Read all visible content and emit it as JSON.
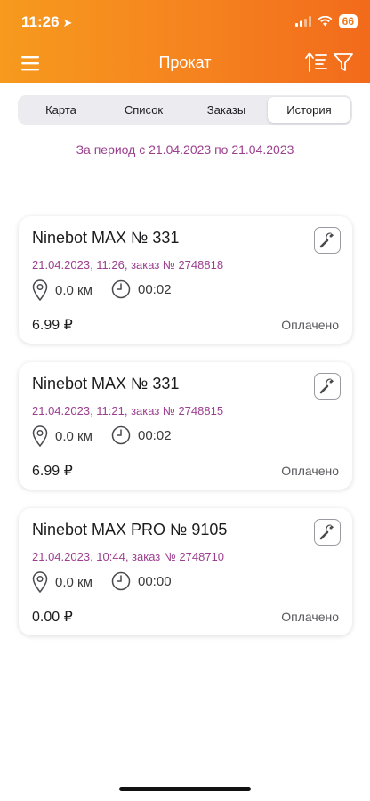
{
  "status_bar": {
    "time": "11:26",
    "battery": "66"
  },
  "header": {
    "title": "Прокат"
  },
  "tabs": [
    {
      "label": "Карта"
    },
    {
      "label": "Список"
    },
    {
      "label": "Заказы"
    },
    {
      "label": "История"
    }
  ],
  "active_tab": "История",
  "period": "За период с 21.04.2023 по 21.04.2023",
  "rides": [
    {
      "title": "Ninebot MAX № 331",
      "subtitle": "21.04.2023, 11:26, заказ № 2748818",
      "distance": "0.0 км",
      "duration": "00:02",
      "price": "6.99 ₽",
      "status": "Оплачено"
    },
    {
      "title": "Ninebot MAX № 331",
      "subtitle": "21.04.2023, 11:21, заказ № 2748815",
      "distance": "0.0 км",
      "duration": "00:02",
      "price": "6.99 ₽",
      "status": "Оплачено"
    },
    {
      "title": "Ninebot MAX PRO № 9105",
      "subtitle": "21.04.2023, 10:44, заказ № 2748710",
      "distance": "0.0 км",
      "duration": "00:00",
      "price": "0.00 ₽",
      "status": "Оплачено"
    }
  ],
  "colors": {
    "header_gradient_start": "#f79a1e",
    "header_gradient_end": "#f26a1b",
    "accent_text": "#9c3f8f"
  }
}
